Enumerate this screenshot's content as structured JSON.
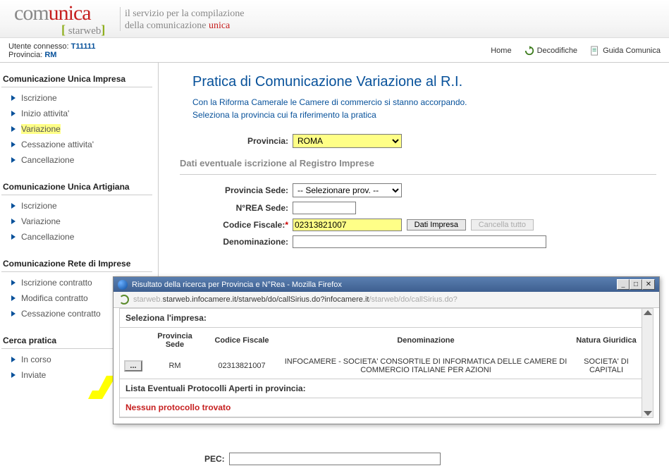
{
  "logo": {
    "com": "com",
    "unica": "unica",
    "starweb": "starweb"
  },
  "tagline": {
    "line1": "il servizio per la compilazione",
    "line2_a": "della comunicazione ",
    "line2_b": "unica"
  },
  "userbar": {
    "connected_label": "Utente connesso: ",
    "user": "T11111",
    "provincia_label": "Provincia: ",
    "provincia": "RM",
    "home": "Home",
    "decodifiche": "Decodifiche",
    "guida": "Guida Comunica"
  },
  "sidebar": {
    "sections": [
      {
        "title": "Comunicazione Unica Impresa",
        "items": [
          "Iscrizione",
          "Inizio attivita'",
          "Variazione",
          "Cessazione attivita'",
          "Cancellazione"
        ],
        "highlight_index": 2
      },
      {
        "title": "Comunicazione Unica Artigiana",
        "items": [
          "Iscrizione",
          "Variazione",
          "Cancellazione"
        ]
      },
      {
        "title": "Comunicazione Rete di Imprese",
        "items": [
          "Iscrizione contratto",
          "Modifica contratto",
          "Cessazione contratto"
        ]
      },
      {
        "title": "Cerca pratica",
        "items": [
          "In corso",
          "Inviate"
        ]
      }
    ]
  },
  "page": {
    "title": "Pratica di Comunicazione Variazione al R.I.",
    "notice1": "Con la Riforma Camerale le Camere di commercio si stanno accorpando.",
    "notice2": "Seleziona la provincia cui fa riferimento la pratica",
    "provincia_label": "Provincia:",
    "provincia_value": "ROMA",
    "section2": "Dati eventuale iscrizione al Registro Imprese",
    "prov_sede_label": "Provincia Sede:",
    "prov_sede_value": "-- Selezionare prov. --",
    "nrea_label": "N°REA Sede:",
    "cf_label": "Codice Fiscale:",
    "cf_value": "02313821007",
    "dati_impresa_btn": "Dati Impresa",
    "cancella_btn": "Cancella tutto",
    "denom_label": "Denominazione:",
    "pec_label": "PEC:"
  },
  "popup": {
    "title": "Risultato della ricerca per Provincia e N°Rea - Mozilla Firefox",
    "url": "starweb.infocamere.it/starweb/do/callSirius.do?",
    "seleziona": "Seleziona l'impresa:",
    "cols": {
      "c1": "Provincia Sede",
      "c2": "Codice Fiscale",
      "c3": "Denominazione",
      "c4": "Natura Giuridica"
    },
    "row": {
      "btn": "...",
      "prov": "RM",
      "cf": "02313821007",
      "denom": "INFOCAMERE - SOCIETA' CONSORTILE DI INFORMATICA DELLE CAMERE DI COMMERCIO ITALIANE PER AZIONI",
      "natura": "SOCIETA' DI CAPITALI"
    },
    "lista": "Lista Eventuali Protocolli Aperti in provincia:",
    "none": "Nessun protocollo trovato"
  }
}
